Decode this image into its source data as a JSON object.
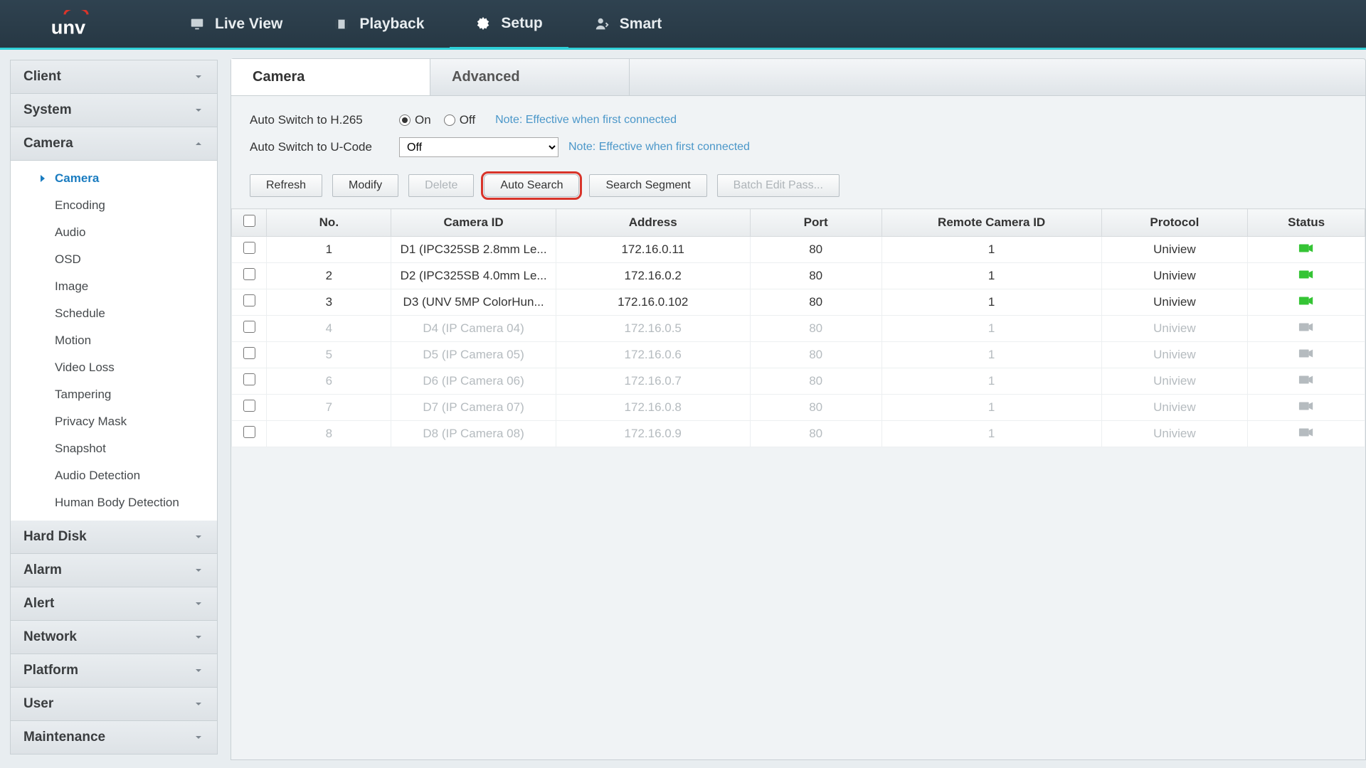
{
  "brand": "unv",
  "nav": [
    {
      "id": "live",
      "label": "Live View"
    },
    {
      "id": "playback",
      "label": "Playback"
    },
    {
      "id": "setup",
      "label": "Setup",
      "active": true
    },
    {
      "id": "smart",
      "label": "Smart"
    }
  ],
  "sidebar": {
    "sections": [
      {
        "id": "client",
        "label": "Client",
        "expanded": false
      },
      {
        "id": "system",
        "label": "System",
        "expanded": false
      },
      {
        "id": "camera",
        "label": "Camera",
        "expanded": true,
        "items": [
          {
            "id": "camera",
            "label": "Camera",
            "active": true
          },
          {
            "id": "encoding",
            "label": "Encoding"
          },
          {
            "id": "audio",
            "label": "Audio"
          },
          {
            "id": "osd",
            "label": "OSD"
          },
          {
            "id": "image",
            "label": "Image"
          },
          {
            "id": "schedule",
            "label": "Schedule"
          },
          {
            "id": "motion",
            "label": "Motion"
          },
          {
            "id": "videoloss",
            "label": "Video Loss"
          },
          {
            "id": "tampering",
            "label": "Tampering"
          },
          {
            "id": "privacymask",
            "label": "Privacy Mask"
          },
          {
            "id": "snapshot",
            "label": "Snapshot"
          },
          {
            "id": "audiodetection",
            "label": "Audio Detection"
          },
          {
            "id": "humanbody",
            "label": "Human Body Detection"
          }
        ]
      },
      {
        "id": "harddisk",
        "label": "Hard Disk",
        "expanded": false
      },
      {
        "id": "alarm",
        "label": "Alarm",
        "expanded": false
      },
      {
        "id": "alert",
        "label": "Alert",
        "expanded": false
      },
      {
        "id": "network",
        "label": "Network",
        "expanded": false
      },
      {
        "id": "platform",
        "label": "Platform",
        "expanded": false
      },
      {
        "id": "user",
        "label": "User",
        "expanded": false
      },
      {
        "id": "maintenance",
        "label": "Maintenance",
        "expanded": false
      }
    ]
  },
  "tabs": [
    {
      "id": "camera",
      "label": "Camera",
      "active": true
    },
    {
      "id": "advanced",
      "label": "Advanced"
    }
  ],
  "settings": {
    "h265_label": "Auto Switch to H.265",
    "h265_on_label": "On",
    "h265_off_label": "Off",
    "h265_value": "On",
    "h265_note": "Note: Effective when first connected",
    "ucode_label": "Auto Switch to U-Code",
    "ucode_value": "Off",
    "ucode_note": "Note: Effective when first connected"
  },
  "buttons": {
    "refresh": "Refresh",
    "modify": "Modify",
    "delete": "Delete",
    "autosearch": "Auto Search",
    "searchsegment": "Search Segment",
    "batchedit": "Batch Edit Pass..."
  },
  "table": {
    "headers": {
      "no": "No.",
      "camera_id": "Camera ID",
      "address": "Address",
      "port": "Port",
      "remote": "Remote Camera ID",
      "protocol": "Protocol",
      "status": "Status"
    },
    "rows": [
      {
        "no": "1",
        "camera_id": "D1 (IPC325SB 2.8mm Le...",
        "address": "172.16.0.11",
        "port": "80",
        "remote": "1",
        "protocol": "Uniview",
        "online": true
      },
      {
        "no": "2",
        "camera_id": "D2 (IPC325SB 4.0mm Le...",
        "address": "172.16.0.2",
        "port": "80",
        "remote": "1",
        "protocol": "Uniview",
        "online": true
      },
      {
        "no": "3",
        "camera_id": "D3 (UNV 5MP ColorHun...",
        "address": "172.16.0.102",
        "port": "80",
        "remote": "1",
        "protocol": "Uniview",
        "online": true
      },
      {
        "no": "4",
        "camera_id": "D4 (IP Camera 04)",
        "address": "172.16.0.5",
        "port": "80",
        "remote": "1",
        "protocol": "Uniview",
        "online": false
      },
      {
        "no": "5",
        "camera_id": "D5 (IP Camera 05)",
        "address": "172.16.0.6",
        "port": "80",
        "remote": "1",
        "protocol": "Uniview",
        "online": false
      },
      {
        "no": "6",
        "camera_id": "D6 (IP Camera 06)",
        "address": "172.16.0.7",
        "port": "80",
        "remote": "1",
        "protocol": "Uniview",
        "online": false
      },
      {
        "no": "7",
        "camera_id": "D7 (IP Camera 07)",
        "address": "172.16.0.8",
        "port": "80",
        "remote": "1",
        "protocol": "Uniview",
        "online": false
      },
      {
        "no": "8",
        "camera_id": "D8 (IP Camera 08)",
        "address": "172.16.0.9",
        "port": "80",
        "remote": "1",
        "protocol": "Uniview",
        "online": false
      }
    ]
  }
}
